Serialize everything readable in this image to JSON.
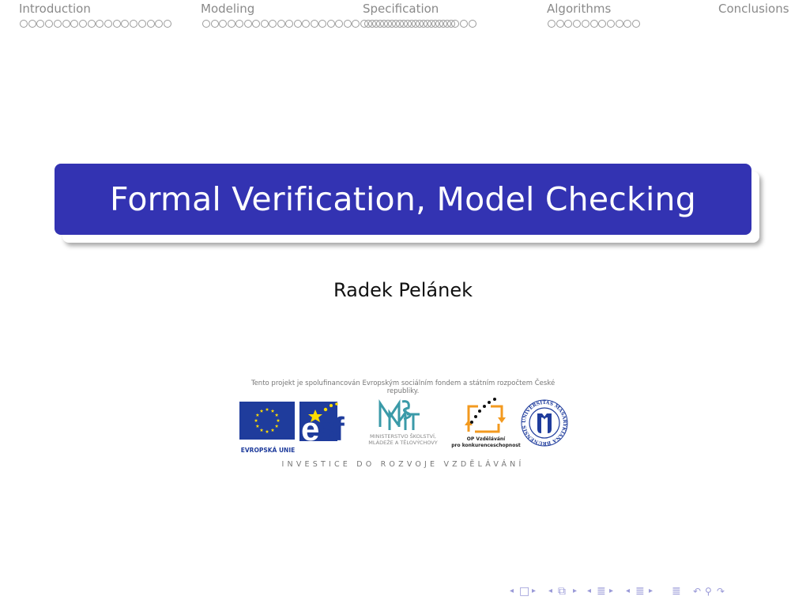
{
  "header": {
    "sections": [
      {
        "label": "Introduction",
        "dots": 18,
        "active": false
      },
      {
        "label": "Modeling",
        "dots": 19,
        "active": false
      },
      {
        "label": "Specification",
        "dots": 26,
        "active": false
      },
      {
        "label": "Algorithms",
        "dots": 11,
        "active": false
      },
      {
        "label": "Conclusions",
        "dots": 0,
        "active": false
      }
    ]
  },
  "title": {
    "text": "Formal Verification, Model Checking",
    "box_color": "#3333b2"
  },
  "author": "Radek Pelánek",
  "funding": {
    "statement": "Tento projekt je spolufinancován Evropským sociálním fondem a státním rozpočtem České republiky.",
    "logos": {
      "eu": {
        "caption": "EVROPSKÁ UNIE"
      },
      "esf": {
        "text": "esf"
      },
      "msmt": {
        "mark": "MŠMT",
        "caption_line1": "MINISTERSTVO ŠKOLSTVÍ,",
        "caption_line2": "MLÁDEŽE A TĚLOVÝCHOVY"
      },
      "op": {
        "caption_line1": "OP Vzdělávání",
        "caption_line2": "pro konkurenceschopnost"
      },
      "mu": {
        "ring_text": "UNIVERSITAS MASARYKIANA BRUNENSIS",
        "mark": "MU"
      }
    },
    "slogan": "INVESTICE DO ROZVOJE VZDĚLÁVÁNÍ"
  },
  "beamer_nav": {
    "items": [
      {
        "name": "prev-slide-icon",
        "glyph": "◂"
      },
      {
        "name": "slide-icon",
        "glyph": "□"
      },
      {
        "name": "next-slide-icon",
        "glyph": "▸"
      },
      {
        "name": "prev-frame-icon",
        "glyph": "◂"
      },
      {
        "name": "frame-icon",
        "glyph": "⧉"
      },
      {
        "name": "next-frame-icon",
        "glyph": "▸"
      },
      {
        "name": "prev-subsection-icon",
        "glyph": "◂"
      },
      {
        "name": "subsection-icon",
        "glyph": "≣"
      },
      {
        "name": "next-subsection-icon",
        "glyph": "▸"
      },
      {
        "name": "prev-section-icon",
        "glyph": "◂"
      },
      {
        "name": "section-icon",
        "glyph": "≣"
      },
      {
        "name": "next-section-icon",
        "glyph": "▸"
      },
      {
        "name": "document-icon",
        "glyph": "≣"
      },
      {
        "name": "back-icon",
        "glyph": "↶"
      },
      {
        "name": "search-icon",
        "glyph": "⚲"
      },
      {
        "name": "forward-icon",
        "glyph": "↷"
      }
    ]
  }
}
